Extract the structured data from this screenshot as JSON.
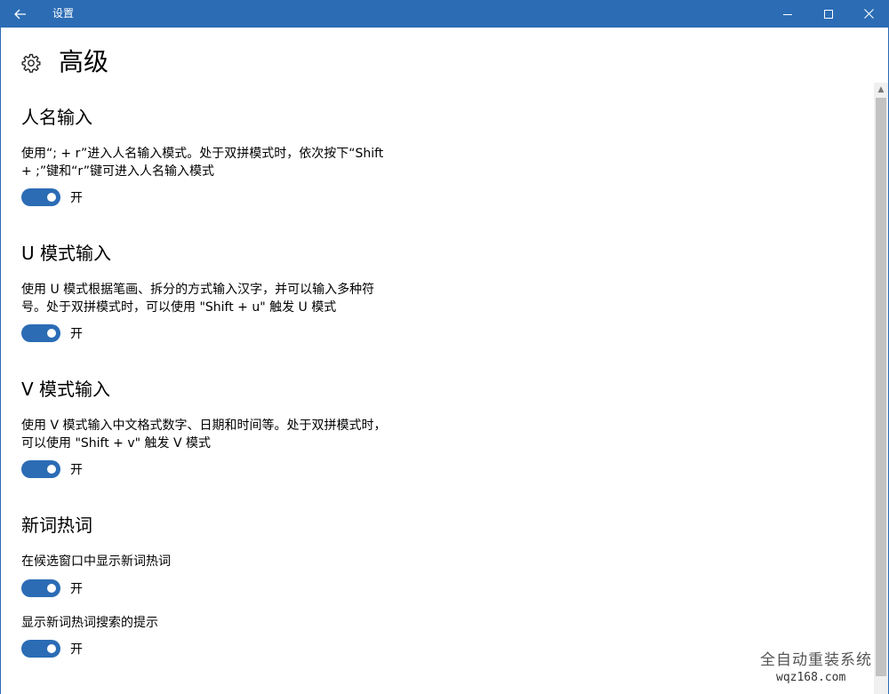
{
  "window": {
    "title": "设置",
    "back_icon": "arrow-left-icon",
    "controls": [
      "minimize-icon",
      "maximize-icon",
      "close-icon"
    ],
    "accent": "#2b6cb5"
  },
  "page": {
    "icon": "gear-icon",
    "title": "高级"
  },
  "sections": [
    {
      "title": "人名输入",
      "desc_line1": "使用“; + r”进入人名输入模式。处于双拼模式时，依次按下“Shift",
      "desc_line2": "+ ;”键和“r”键可进入人名输入模式",
      "toggle_label": "开",
      "toggle_on": true
    },
    {
      "title": "U 模式输入",
      "desc_line1": "使用 U 模式根据笔画、拆分的方式输入汉字，并可以输入多种符",
      "desc_line2": "号。处于双拼模式时，可以使用 \"Shift + u\" 触发 U 模式",
      "toggle_label": "开",
      "toggle_on": true
    },
    {
      "title": "V 模式输入",
      "desc_line1": "使用 V 模式输入中文格式数字、日期和时间等。处于双拼模式时，",
      "desc_line2": "可以使用 \"Shift + v\" 触发 V 模式",
      "toggle_label": "开",
      "toggle_on": true
    },
    {
      "title": "新词热词",
      "items": [
        {
          "label": "在候选窗口中显示新词热词",
          "toggle_label": "开",
          "toggle_on": true
        },
        {
          "label": "显示新词热词搜索的提示",
          "toggle_label": "开",
          "toggle_on": true
        }
      ]
    }
  ],
  "watermark": {
    "main": "全自动重装系统",
    "sub": "wqz168.com"
  }
}
